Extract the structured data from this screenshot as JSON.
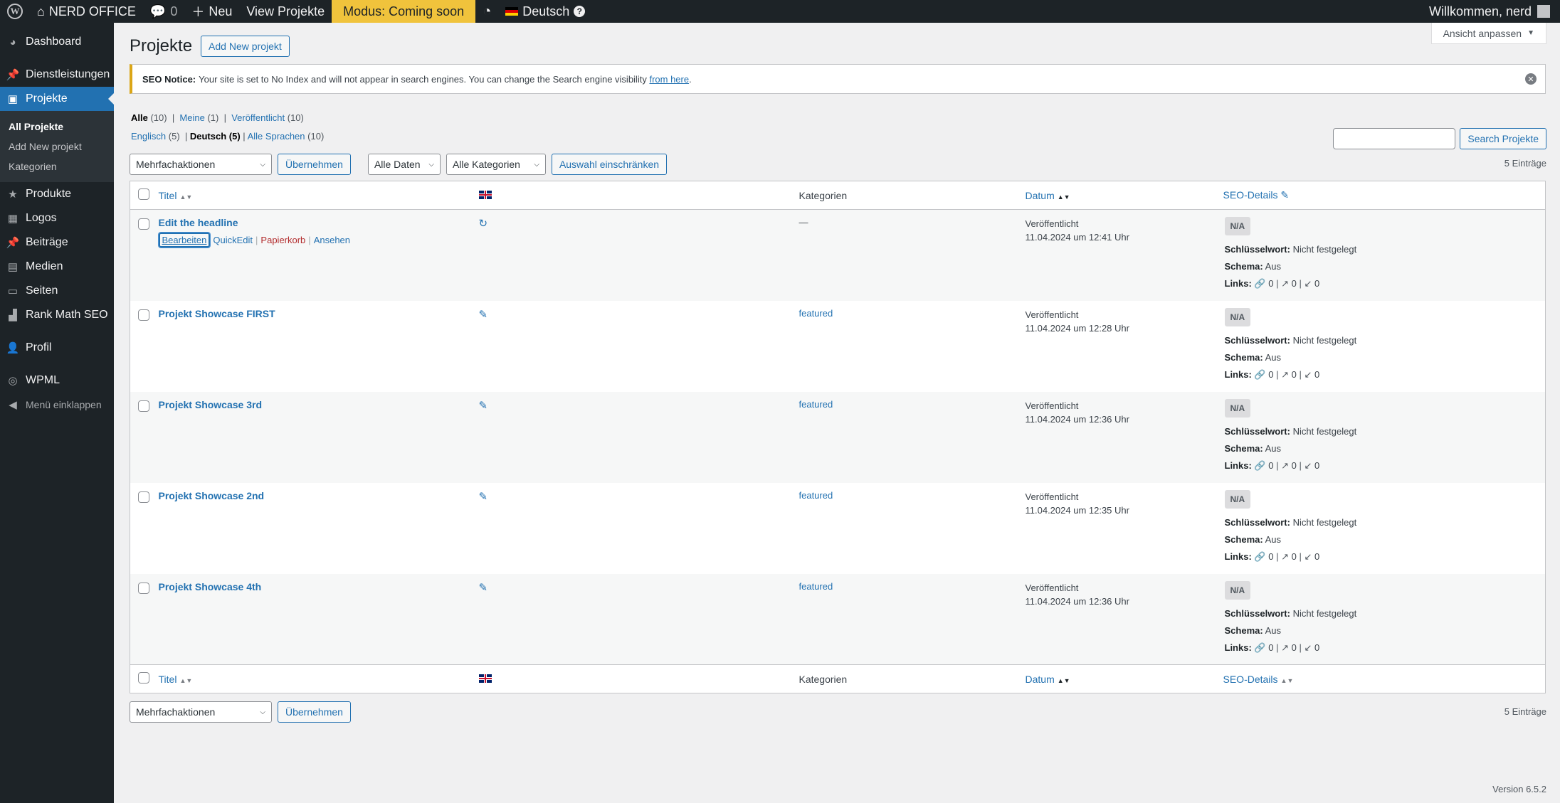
{
  "adminbar": {
    "site_name": "NERD OFFICE",
    "comments_count": "0",
    "new_label": "Neu",
    "view_label": "View Projekte",
    "mode_label": "Modus: Coming soon",
    "language": "Deutsch",
    "greeting": "Willkommen, nerd"
  },
  "sidebar": {
    "items": [
      {
        "label": "Dashboard",
        "icon": "dashboard-icon"
      },
      {
        "label": "Dienstleistungen",
        "icon": "pin-icon"
      },
      {
        "label": "Projekte",
        "icon": "portfolio-icon",
        "current": true
      },
      {
        "label": "Produkte",
        "icon": "star-icon"
      },
      {
        "label": "Logos",
        "icon": "image-icon"
      },
      {
        "label": "Beiträge",
        "icon": "pin-icon"
      },
      {
        "label": "Medien",
        "icon": "media-icon"
      },
      {
        "label": "Seiten",
        "icon": "page-icon"
      },
      {
        "label": "Rank Math SEO",
        "icon": "chart-icon"
      },
      {
        "label": "Profil",
        "icon": "user-icon"
      },
      {
        "label": "WPML",
        "icon": "wpml-icon"
      },
      {
        "label": "Menü einklappen",
        "icon": "collapse-icon"
      }
    ],
    "submenu": [
      "All Projekte",
      "Add New projekt",
      "Kategorien"
    ]
  },
  "header": {
    "screen_options": "Ansicht anpassen",
    "title": "Projekte",
    "add_new": "Add New projekt"
  },
  "notice": {
    "label": "SEO Notice:",
    "text": "Your site is set to No Index and will not appear in search engines. You can change the Search engine visibility",
    "link": "from here",
    "end": "."
  },
  "views": {
    "all": "Alle",
    "all_count": "(10)",
    "mine": "Meine",
    "mine_count": "(1)",
    "published": "Veröffentlicht",
    "published_count": "(10)"
  },
  "langs": {
    "en": "Englisch",
    "en_count": "(5)",
    "de": "Deutsch",
    "de_count": "(5)",
    "all": "Alle Sprachen",
    "all_count": "(10)"
  },
  "search": {
    "button": "Search Projekte"
  },
  "filters": {
    "bulk": "Mehrfachaktionen",
    "apply": "Übernehmen",
    "dates": "Alle Daten",
    "cats": "Alle Kategorien",
    "filter_btn": "Auswahl einschränken",
    "count": "5 Einträge"
  },
  "columns": {
    "title": "Titel",
    "categories": "Kategorien",
    "date": "Datum",
    "seo": "SEO-Details"
  },
  "rows": [
    {
      "title": "Edit the headline",
      "category": "—",
      "status": "Veröffentlicht",
      "date": "11.04.2024 um 12:41 Uhr"
    },
    {
      "title": "Projekt Showcase FIRST",
      "category": "featured",
      "status": "Veröffentlicht",
      "date": "11.04.2024 um 12:28 Uhr"
    },
    {
      "title": "Projekt Showcase 3rd",
      "category": "featured",
      "status": "Veröffentlicht",
      "date": "11.04.2024 um 12:36 Uhr"
    },
    {
      "title": "Projekt Showcase 2nd",
      "category": "featured",
      "status": "Veröffentlicht",
      "date": "11.04.2024 um 12:35 Uhr"
    },
    {
      "title": "Projekt Showcase 4th",
      "category": "featured",
      "status": "Veröffentlicht",
      "date": "11.04.2024 um 12:36 Uhr"
    }
  ],
  "row_actions": {
    "edit": "Bearbeiten",
    "quickedit": "QuickEdit",
    "trash": "Papierkorb",
    "view": "Ansehen"
  },
  "seo": {
    "badge": "N/A",
    "keyword_label": "Schlüsselwort:",
    "keyword_value": "Nicht festgelegt",
    "schema_label": "Schema:",
    "schema_value": "Aus",
    "links_label": "Links:",
    "link_count": "0"
  },
  "footer": {
    "version": "Version 6.5.2"
  }
}
